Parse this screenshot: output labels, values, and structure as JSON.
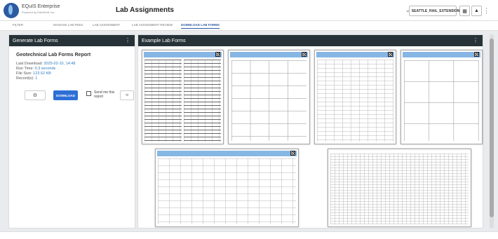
{
  "app": {
    "brand_name": "EQuIS Enterprise",
    "brand_sub": "Powered by EarthSoft, Inc.",
    "page_title": "Lab Assignments",
    "project_button": "SEATTLE_RAIL_EXTENSION"
  },
  "tabs": [
    {
      "label": "FILTER",
      "active": false
    },
    {
      "label": "MANAGE LAB FEES",
      "active": false
    },
    {
      "label": "LAB ASSIGNMENT",
      "active": false
    },
    {
      "label": "LAB ASSIGNMENT REVIEW",
      "active": false
    },
    {
      "label": "DOWNLOAD LAB FORMS",
      "active": true
    }
  ],
  "left_panel": {
    "header": "Generate Lab Forms",
    "report_title": "Geotechnical Lab Forms Report",
    "last_download_label": "Last Download:",
    "last_download_value": "2025-02-10, 14:48",
    "run_time_label": "Run Time:",
    "run_time_value": "0.3 seconds",
    "file_size_label": "File Size:",
    "file_size_value": "123.52 KB",
    "records_label": "Record(s):",
    "records_value": "1",
    "download_label": "DOWNLOAD",
    "send_label": "Send me this report"
  },
  "right_panel": {
    "header": "Example Lab Forms"
  },
  "icons": {
    "settings": "gear-icon",
    "share": "share-icon",
    "person": "person-icon",
    "grid": "grid-icon",
    "bell": "bell-icon"
  },
  "colors": {
    "header_dark": "#263238",
    "accent_blue": "#2e6fd6",
    "link_blue": "#2e7bbf",
    "form_header": "#86b6e4"
  }
}
